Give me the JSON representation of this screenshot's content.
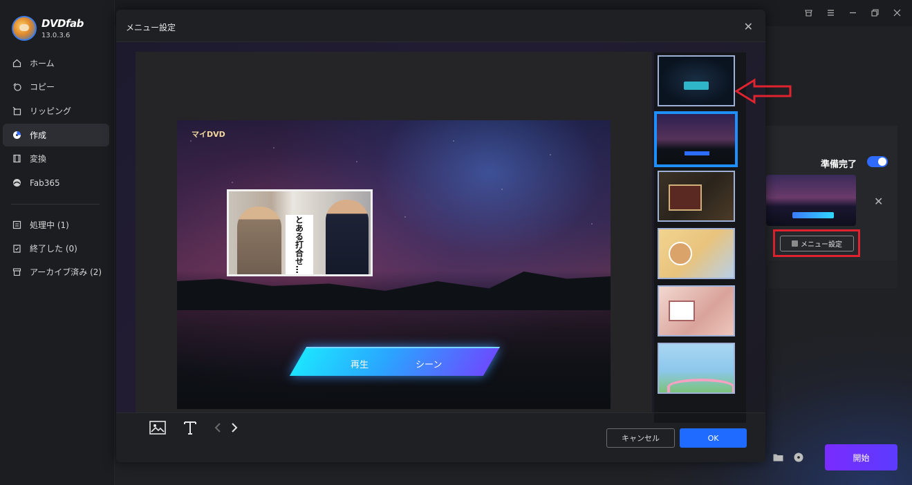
{
  "app": {
    "name": "DVDfab",
    "version": "13.0.3.6"
  },
  "sidebar": {
    "items": [
      {
        "label": "ホーム",
        "icon": "home-icon"
      },
      {
        "label": "コピー",
        "icon": "copy-icon"
      },
      {
        "label": "リッピング",
        "icon": "ripping-icon"
      },
      {
        "label": "作成",
        "icon": "create-disc-icon",
        "active": true
      },
      {
        "label": "変換",
        "icon": "convert-icon"
      },
      {
        "label": "Fab365",
        "icon": "fab365-icon"
      }
    ],
    "queue": [
      {
        "label": "処理中 (1)",
        "icon": "processing-icon"
      },
      {
        "label": "終了した (0)",
        "icon": "finished-icon"
      },
      {
        "label": "アーカイブ済み (2)",
        "icon": "archive-icon"
      }
    ]
  },
  "task": {
    "ready_label": "準備完了",
    "ready_on": true,
    "menu_button_label": "メニュー設定"
  },
  "start_button_label": "開始",
  "dialog": {
    "title": "メニュー設定",
    "preview": {
      "title": "マイDVD",
      "photo_caption": "とある打合せ…",
      "play_label": "再生",
      "scene_label": "シーン"
    },
    "cancel_label": "キャンセル",
    "ok_label": "OK",
    "templates_count": 6,
    "selected_template": 2
  },
  "colors": {
    "accent": "#1f6bff",
    "highlight_red": "#e0232f",
    "start_purple": "#6a34ff"
  }
}
